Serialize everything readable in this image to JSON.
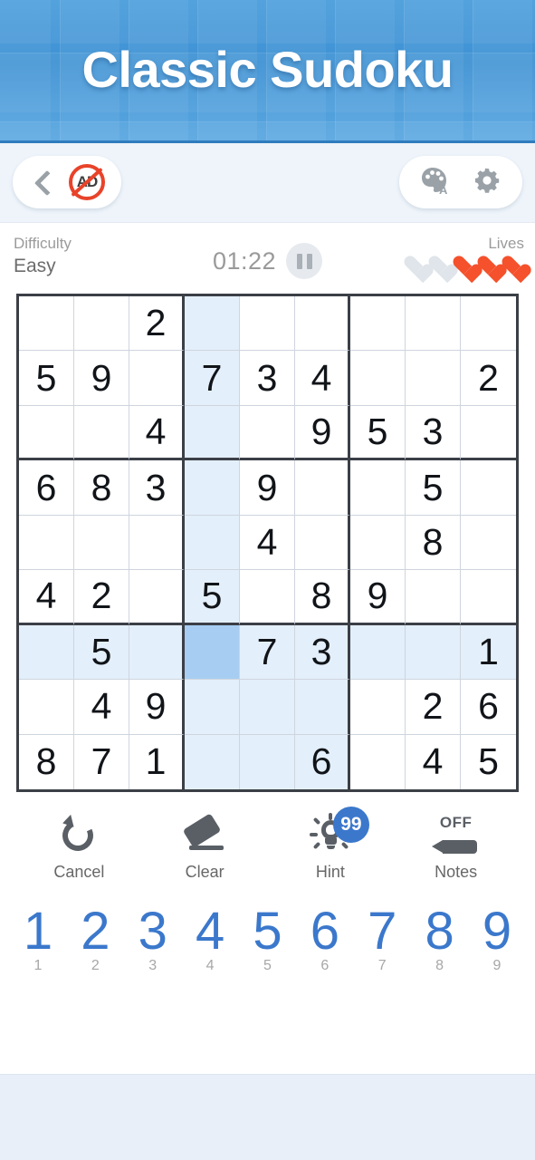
{
  "header": {
    "title": "Classic Sudoku"
  },
  "toolbar": {
    "back_icon": "chevron-left-icon",
    "no_ads_label": "AD",
    "theme_icon": "palette-a-icon",
    "settings_icon": "gear-icon"
  },
  "status": {
    "difficulty_label": "Difficulty",
    "difficulty_value": "Easy",
    "timer": "01:22",
    "pause_icon": "pause-icon",
    "lives_label": "Lives",
    "lives_total": 5,
    "lives_remaining": 3,
    "heart_empty_color": "#dfe5ea",
    "heart_full_color": "#f4512c"
  },
  "board": {
    "rows": [
      [
        "",
        "",
        "2",
        "",
        "",
        "",
        "",
        "",
        ""
      ],
      [
        "5",
        "9",
        "",
        "7",
        "3",
        "4",
        "",
        "",
        "2"
      ],
      [
        "",
        "",
        "4",
        "",
        "",
        "9",
        "5",
        "3",
        ""
      ],
      [
        "6",
        "8",
        "3",
        "",
        "9",
        "",
        "",
        "5",
        ""
      ],
      [
        "",
        "",
        "",
        "",
        "4",
        "",
        "",
        "8",
        ""
      ],
      [
        "4",
        "2",
        "",
        "5",
        "",
        "8",
        "9",
        "",
        ""
      ],
      [
        "",
        "5",
        "",
        "",
        "7",
        "3",
        "",
        "",
        "1"
      ],
      [
        "",
        "4",
        "9",
        "",
        "",
        "",
        "",
        "2",
        "6"
      ],
      [
        "8",
        "7",
        "1",
        "",
        "",
        "6",
        "",
        "4",
        "5"
      ]
    ],
    "selected": {
      "row": 7,
      "col": 4
    },
    "highlight_color": "#e3effb",
    "selected_color": "#a7cdf2"
  },
  "actions": [
    {
      "label": "Cancel",
      "icon": "undo-icon"
    },
    {
      "label": "Clear",
      "icon": "eraser-icon"
    },
    {
      "label": "Hint",
      "icon": "lightbulb-icon",
      "badge": "99"
    },
    {
      "label": "Notes",
      "icon": "pencil-icon",
      "state": "OFF"
    }
  ],
  "numpad": [
    {
      "value": "1",
      "count": "1"
    },
    {
      "value": "2",
      "count": "2"
    },
    {
      "value": "3",
      "count": "3"
    },
    {
      "value": "4",
      "count": "4"
    },
    {
      "value": "5",
      "count": "5"
    },
    {
      "value": "6",
      "count": "6"
    },
    {
      "value": "7",
      "count": "7"
    },
    {
      "value": "8",
      "count": "8"
    },
    {
      "value": "9",
      "count": "9"
    }
  ],
  "colors": {
    "accent": "#3b78cc",
    "header_blue": "#4a9ddb",
    "grid_line": "#3b3f46"
  }
}
